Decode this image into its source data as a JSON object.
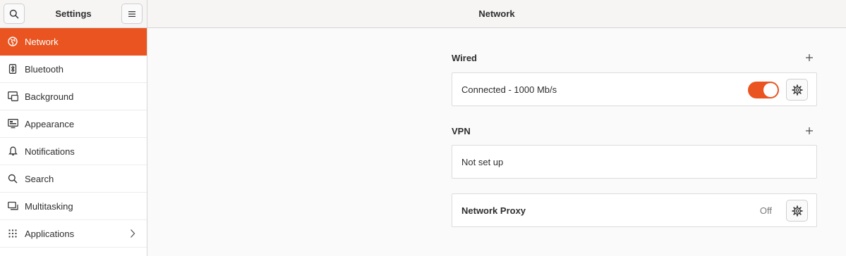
{
  "sidebar": {
    "title": "Settings",
    "search_icon": "search-icon",
    "menu_icon": "hamburger-menu-icon",
    "items": [
      {
        "label": "Network",
        "icon": "globe-icon",
        "active": true
      },
      {
        "label": "Bluetooth",
        "icon": "bluetooth-icon"
      },
      {
        "label": "Background",
        "icon": "background-icon"
      },
      {
        "label": "Appearance",
        "icon": "appearance-icon"
      },
      {
        "label": "Notifications",
        "icon": "bell-icon"
      },
      {
        "label": "Search",
        "icon": "search-icon"
      },
      {
        "label": "Multitasking",
        "icon": "multitasking-icon"
      },
      {
        "label": "Applications",
        "icon": "grid-icon",
        "has_submenu": true
      }
    ]
  },
  "main": {
    "title": "Network",
    "wired": {
      "title": "Wired",
      "connection_status": "Connected - 1000 Mb/s",
      "enabled": true
    },
    "vpn": {
      "title": "VPN",
      "status": "Not set up"
    },
    "proxy": {
      "label": "Network Proxy",
      "status": "Off"
    }
  },
  "colors": {
    "accent": "#e95420",
    "sidebar_bg": "#ffffff",
    "main_bg": "#fafafa"
  }
}
